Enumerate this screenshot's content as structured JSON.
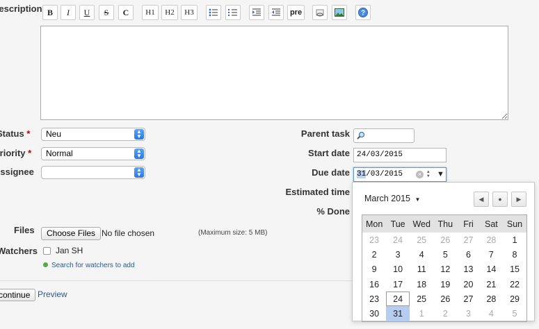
{
  "labels": {
    "description": "Description",
    "status": "Status",
    "priority": "Priority",
    "assignee": "Assignee",
    "parent_task": "Parent task",
    "start_date": "Start date",
    "due_date": "Due date",
    "estimated_time": "Estimated time",
    "done": "% Done",
    "files": "Files",
    "watchers": "Watchers",
    "required_mark": "*"
  },
  "toolbar": [
    "B",
    "I",
    "U",
    "S",
    "C",
    "H1",
    "H2",
    "H3",
    "ul",
    "ol",
    "indent",
    "outdent",
    "pre",
    "link",
    "image",
    "help"
  ],
  "toolbar_text": {
    "b": "B",
    "i": "I",
    "u": "U",
    "s": "S",
    "c": "C",
    "h1": "H1",
    "h2": "H2",
    "h3": "H3",
    "pre": "pre"
  },
  "fields": {
    "status_value": "Neu",
    "priority_value": "Normal",
    "assignee_value": "",
    "start_date_value": "24/03/2015",
    "due_date_day": "31",
    "due_date_rest": "/03/2015"
  },
  "files": {
    "button": "Choose Files",
    "status": "No file chosen",
    "max_size": "(Maximum size: 5 MB)"
  },
  "watchers": {
    "name": "Jan SH",
    "search_link": "Search for watchers to add"
  },
  "actions": {
    "continue": "continue",
    "preview": "Preview"
  },
  "calendar": {
    "month_label": "March 2015",
    "weekdays": [
      "Mon",
      "Tue",
      "Wed",
      "Thu",
      "Fri",
      "Sat",
      "Sun"
    ],
    "weeks": [
      [
        "23",
        "24",
        "25",
        "26",
        "27",
        "28",
        "1"
      ],
      [
        "2",
        "3",
        "4",
        "5",
        "6",
        "7",
        "8"
      ],
      [
        "9",
        "10",
        "11",
        "12",
        "13",
        "14",
        "15"
      ],
      [
        "16",
        "17",
        "18",
        "19",
        "20",
        "21",
        "22"
      ],
      [
        "23",
        "24",
        "25",
        "26",
        "27",
        "28",
        "29"
      ],
      [
        "30",
        "31",
        "1",
        "2",
        "3",
        "4",
        "5"
      ]
    ],
    "out_of_month": [
      [
        0,
        0
      ],
      [
        0,
        1
      ],
      [
        0,
        2
      ],
      [
        0,
        3
      ],
      [
        0,
        4
      ],
      [
        0,
        5
      ],
      [
        5,
        2
      ],
      [
        5,
        3
      ],
      [
        5,
        4
      ],
      [
        5,
        5
      ],
      [
        5,
        6
      ]
    ],
    "today": [
      4,
      1
    ],
    "selected": [
      5,
      1
    ]
  },
  "colors": {
    "link": "#2a5a8a",
    "required": "#bb0000",
    "selected_day": "#b7cdf0",
    "select_arrow": "#2b76e5"
  }
}
